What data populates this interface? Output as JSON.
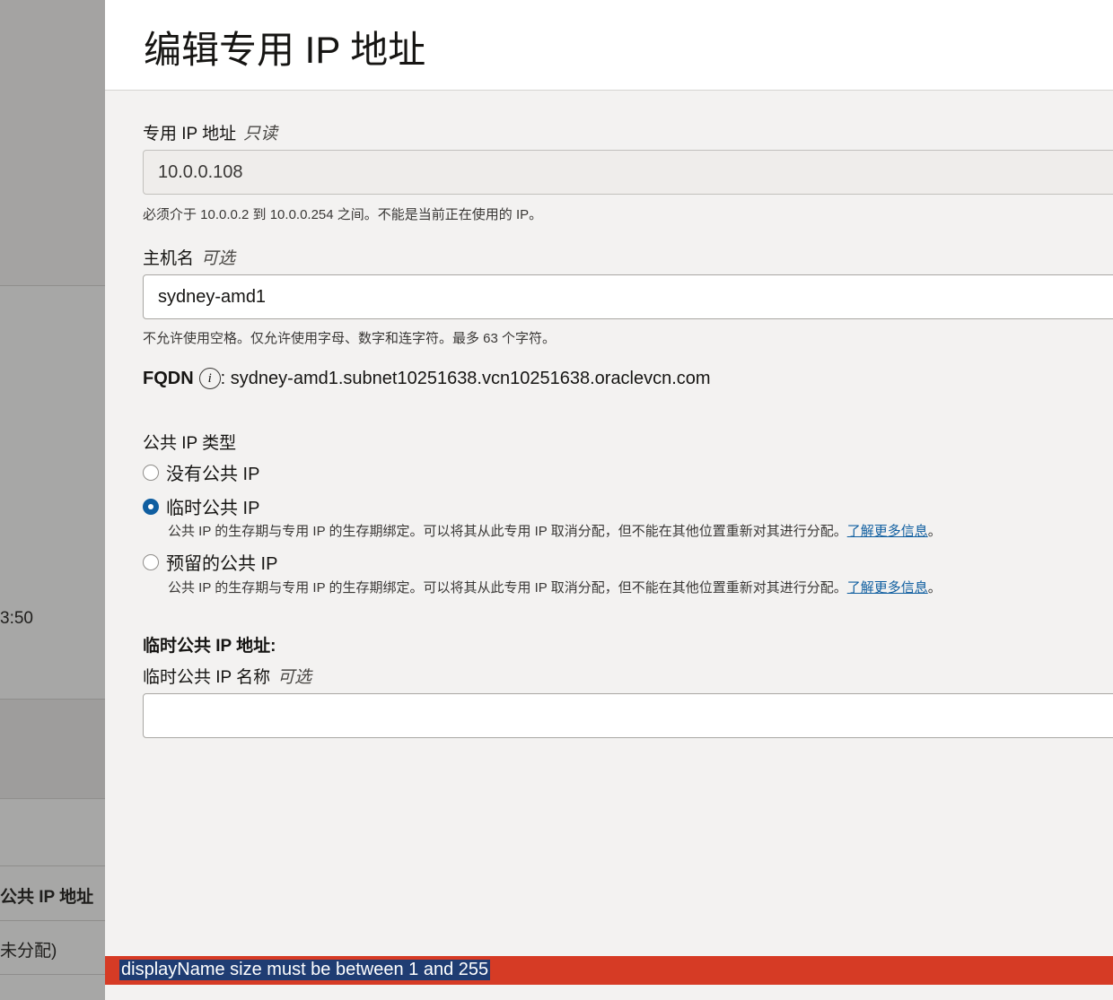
{
  "background": {
    "time_fragment": "3:50",
    "column_header": "公共 IP 地址",
    "cell_value": "未分配)"
  },
  "panel": {
    "title": "编辑专用 IP 地址",
    "private_ip": {
      "label": "专用 IP 地址",
      "tag": "只读",
      "value": "10.0.0.108",
      "help": "必须介于 10.0.0.2 到 10.0.0.254 之间。不能是当前正在使用的 IP。"
    },
    "hostname": {
      "label": "主机名",
      "tag": "可选",
      "value": "sydney-amd1",
      "help": "不允许使用空格。仅允许使用字母、数字和连字符。最多 63 个字符。"
    },
    "fqdn": {
      "label": "FQDN",
      "value": ": sydney-amd1.subnet10251638.vcn10251638.oraclevcn.com"
    },
    "public_ip_type": {
      "label": "公共 IP 类型",
      "options": [
        {
          "label": "没有公共 IP",
          "checked": false
        },
        {
          "label": "临时公共 IP",
          "checked": true,
          "help": "公共 IP 的生存期与专用 IP 的生存期绑定。可以将其从此专用 IP 取消分配，但不能在其他位置重新对其进行分配。",
          "link": "了解更多信息",
          "suffix": "。"
        },
        {
          "label": "预留的公共 IP",
          "checked": false,
          "help": "公共 IP 的生存期与专用 IP 的生存期绑定。可以将其从此专用 IP 取消分配，但不能在其他位置重新对其进行分配。",
          "link": "了解更多信息",
          "suffix": "。"
        }
      ]
    },
    "ephemeral_section": {
      "title": "临时公共 IP 地址:",
      "name_label": "临时公共 IP 名称",
      "name_tag": "可选",
      "name_value": ""
    },
    "error": "displayName size must be between 1 and 255"
  },
  "colors": {
    "accent": "#0f5ea0",
    "error": "#d63b25"
  }
}
